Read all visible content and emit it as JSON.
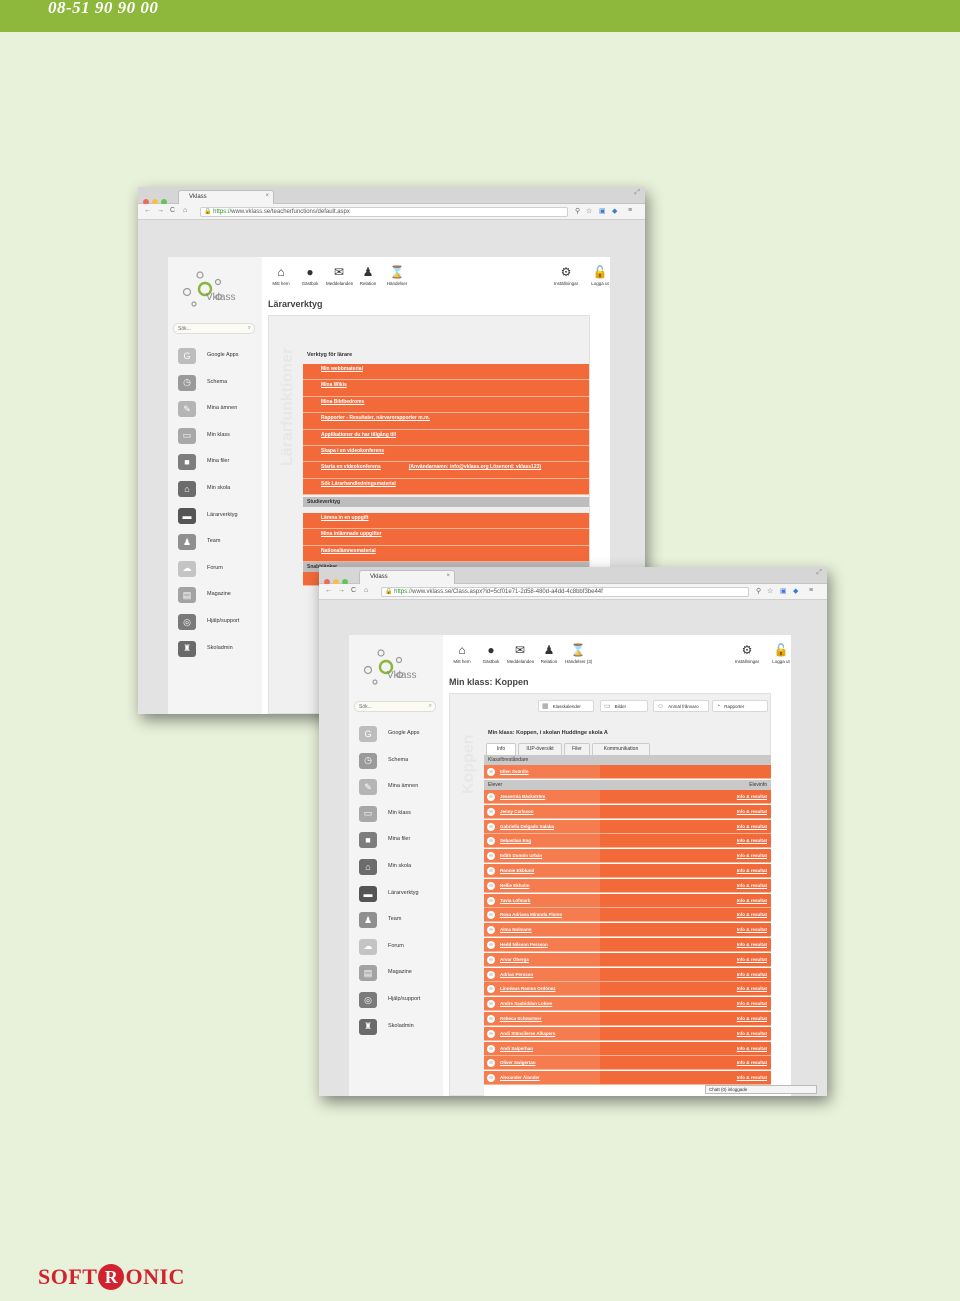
{
  "header": {
    "phone": "08-51 90 90 00"
  },
  "footer_logo": {
    "left": "SOFT",
    "badge": "R",
    "right": "ONIC",
    "color": "#d2222f"
  },
  "win1": {
    "tab_title": "Vklass",
    "url_https": "https://",
    "url_rest": "www.vklass.se/teacherfunctions/default.aspx",
    "brand": "Vklass",
    "search_placeholder": "Sök...",
    "page_title": "Lärarverktyg",
    "vertical_title": "Lärarfunktioner",
    "section_teacher": "Verktyg för lärare",
    "teacher_links": [
      "Min webbmaterial",
      "Mina Wikis",
      "Mina Bildbedroms",
      "Rapporter - Resultater, närvarorapporter m.m.",
      "Applikationer du har tillgång till",
      "Skapa i en videokonferens",
      "Starta en videokonferens",
      "Sök Lärarhandledningsmaterial"
    ],
    "extra_text": "(Användarnamn: info@vklass.org Lösenord: vklass123)",
    "section_study": "Studieverktyg",
    "study_links": [
      "Lämna in en uppgift",
      "Mina inlämnade uppgifter",
      "Nationalämnesmaterial"
    ],
    "section_quick": "Snabblänkar"
  },
  "win2": {
    "tab_title": "Vklass",
    "url_https": "https://",
    "url_rest": "www.vklass.se/Class.aspx?id=5cf01e71-2d58-480d-a4dd-4c8bbf3be44f",
    "brand": "Vklass",
    "search_placeholder": "Sök...",
    "page_title": "Min klass: Koppen",
    "vertical_title": "Koppen",
    "class_heading": "Min klass: Koppen, i skolan Huddinge skola A",
    "toolbar": [
      "Klasskalender",
      "Bilder",
      "Anmäl frånvaro",
      "Rapporter"
    ],
    "tabs": [
      "Info",
      "IUP-översikt",
      "Filer",
      "Kommunikation"
    ],
    "section_mentor": "Klassföreståndare",
    "mentor": "Ellen Svärdin",
    "col_student": "Elever",
    "col_contact": "Elevinfo",
    "link_label": "Info & resultat",
    "students": [
      "Jessernia Bäckström",
      "Jenny Carlsson",
      "Gabriella Delgado Salaba",
      "Sebastian Eng",
      "Edith Dumón Urbán",
      "Ronnie Ekblund",
      "Nellie Ekholm",
      "Tuvia Löfmark",
      "Rosa Adriana Miranda Flores",
      "Alma Nolmann",
      "Hedd Nilsson Persson",
      "Arvar Öberga",
      "Adrian Persson",
      "Linnéaus Ramos Ordónez",
      "Andre Saabiddan Lokwe",
      "Rebeca Schwartser",
      "Andi Stäncilerse Alkapers",
      "Andi Salperhan",
      "Oliver Swigertan",
      "Alexander Ålander"
    ],
    "chat": "Chatt (0) inloggade"
  },
  "menu": [
    {
      "label": "Google Apps",
      "icon": "google-icon",
      "glyph": "G",
      "color": "#bdbdbd"
    },
    {
      "label": "Schema",
      "icon": "clock-icon",
      "glyph": "◷",
      "color": "#9a9a9a"
    },
    {
      "label": "Mina ämnen",
      "icon": "pencil-icon",
      "glyph": "✎",
      "color": "#b5b5b5"
    },
    {
      "label": "Min klass",
      "icon": "laptop-icon",
      "glyph": "▭",
      "color": "#a8a8a8"
    },
    {
      "label": "Mina filer",
      "icon": "folder-icon",
      "glyph": "■",
      "color": "#7d7d7d"
    },
    {
      "label": "Min skola",
      "icon": "school-icon",
      "glyph": "⌂",
      "color": "#6c6c6c"
    },
    {
      "label": "Lärarverktyg",
      "icon": "computer-icon",
      "glyph": "▬",
      "color": "#555555"
    },
    {
      "label": "Team",
      "icon": "team-icon",
      "glyph": "♟",
      "color": "#8f8f8f"
    },
    {
      "label": "Forum",
      "icon": "forum-icon",
      "glyph": "☁",
      "color": "#c4c4c4"
    },
    {
      "label": "Magazine",
      "icon": "magazine-icon",
      "glyph": "▤",
      "color": "#a3a3a3"
    },
    {
      "label": "Hjälp/support",
      "icon": "lifebuoy-icon",
      "glyph": "◎",
      "color": "#7a7a7a"
    },
    {
      "label": "Skoladmin",
      "icon": "admin-icon",
      "glyph": "♜",
      "color": "#6a6a6a"
    }
  ],
  "topnav": [
    {
      "label": "Mitt hem",
      "icon": "home-icon",
      "glyph": "⌂"
    },
    {
      "label": "Gästbok",
      "icon": "chat-bubble-icon",
      "glyph": "●"
    },
    {
      "label": "Meddelanden",
      "icon": "envelope-icon",
      "glyph": "✉"
    },
    {
      "label": "Relation",
      "icon": "people-icon",
      "glyph": "♟"
    },
    {
      "label": "Händelser",
      "icon": "hourglass-icon",
      "glyph": "⌛"
    }
  ],
  "topnav_win2_events": "Händelser (3)",
  "topnav_right": [
    {
      "label": "Inställningar",
      "icon": "gear-icon",
      "glyph": "⚙"
    },
    {
      "label": "Logga ut",
      "icon": "padlock-icon",
      "glyph": "🔓"
    }
  ]
}
